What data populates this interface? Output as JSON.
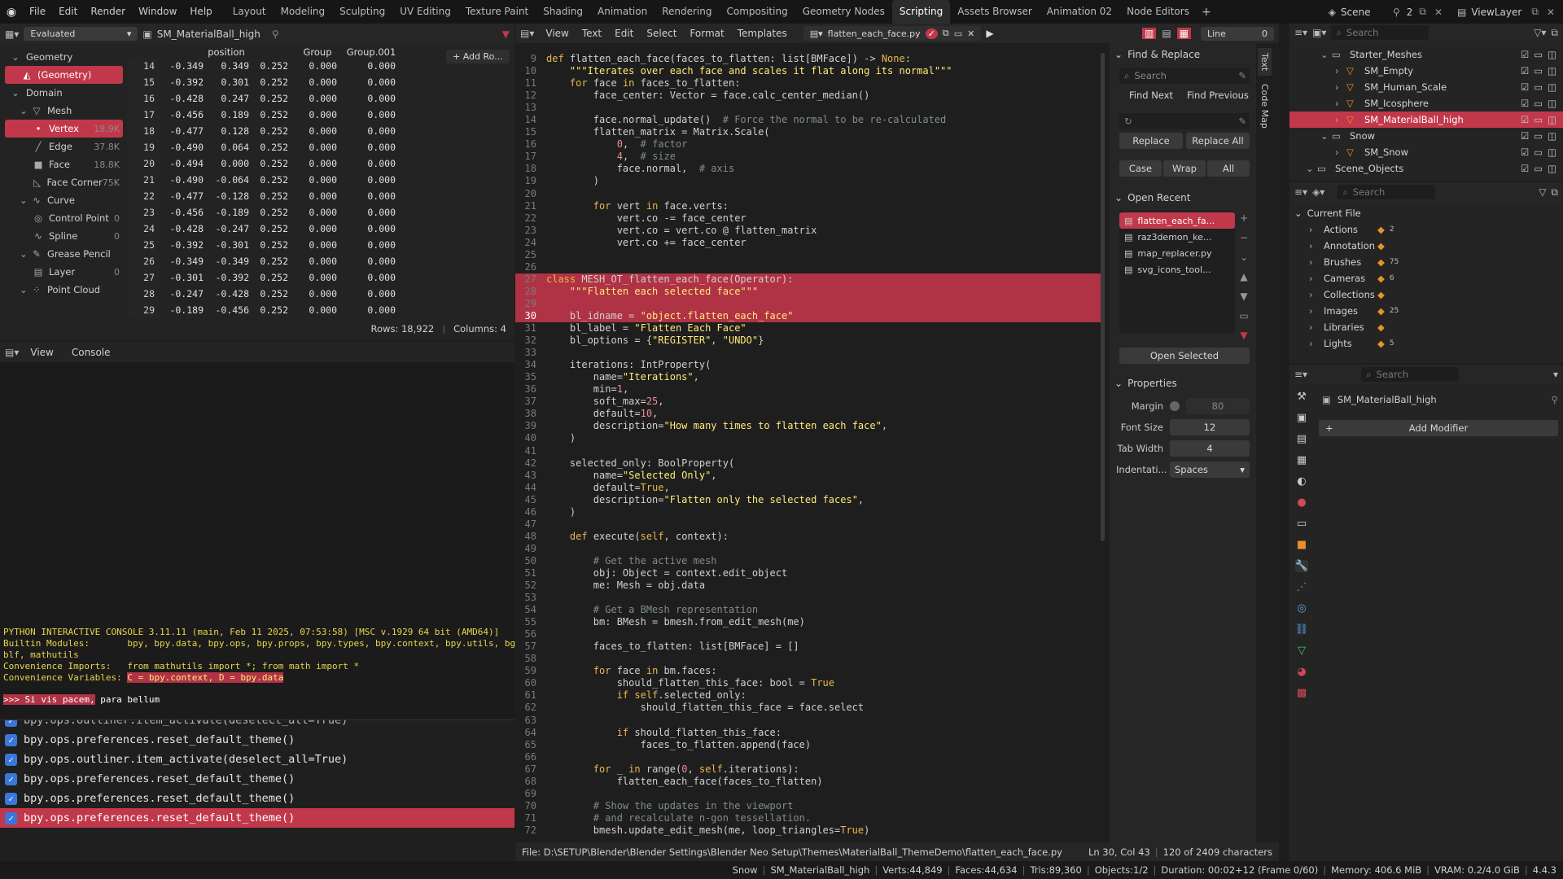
{
  "topbar": {
    "menus": [
      "File",
      "Edit",
      "Render",
      "Window",
      "Help"
    ],
    "workspaces": [
      "Layout",
      "Modeling",
      "Sculpting",
      "UV Editing",
      "Texture Paint",
      "Shading",
      "Animation",
      "Rendering",
      "Compositing",
      "Geometry Nodes",
      "Scripting",
      "Assets Browser",
      "Animation 02",
      "Node Editors"
    ],
    "active_workspace": "Scripting",
    "scene": "Scene",
    "scene_users": "2",
    "view_layer": "ViewLayer"
  },
  "spreadsheet": {
    "evaluated": "Evaluated",
    "object": "SM_MaterialBall_high",
    "tree": [
      {
        "label": "Geometry",
        "count": "",
        "level": 0,
        "sel": false,
        "icon": "chevron-down"
      },
      {
        "label": "(Geometry)",
        "count": "",
        "level": 1,
        "sel": true,
        "icon": "geometry"
      },
      {
        "label": "Domain",
        "count": "",
        "level": 0,
        "sel": false,
        "icon": "chevron-down"
      },
      {
        "label": "Mesh",
        "count": "",
        "level": 1,
        "sel": false,
        "icon": "mesh"
      },
      {
        "label": "Vertex",
        "count": "18.9K",
        "level": 2,
        "sel": true,
        "icon": "vertex"
      },
      {
        "label": "Edge",
        "count": "37.8K",
        "level": 2,
        "sel": false,
        "icon": "edge"
      },
      {
        "label": "Face",
        "count": "18.8K",
        "level": 2,
        "sel": false,
        "icon": "face"
      },
      {
        "label": "Face Corner",
        "count": "75K",
        "level": 2,
        "sel": false,
        "icon": "corner"
      },
      {
        "label": "Curve",
        "count": "",
        "level": 1,
        "sel": false,
        "icon": "curve"
      },
      {
        "label": "Control Point",
        "count": "0",
        "level": 2,
        "sel": false,
        "icon": "point"
      },
      {
        "label": "Spline",
        "count": "0",
        "level": 2,
        "sel": false,
        "icon": "spline"
      },
      {
        "label": "Grease Pencil",
        "count": "",
        "level": 1,
        "sel": false,
        "icon": "gp"
      },
      {
        "label": "Layer",
        "count": "0",
        "level": 2,
        "sel": false,
        "icon": "layer"
      },
      {
        "label": "Point Cloud",
        "count": "",
        "level": 1,
        "sel": false,
        "icon": "cloud"
      }
    ],
    "columns": [
      "position",
      "",
      "",
      "Group",
      "Group.001"
    ],
    "add_row": "+ Add Ro...",
    "rows": [
      [
        "14",
        "-0.349",
        "0.349",
        "0.252",
        "0.000",
        "0.000"
      ],
      [
        "15",
        "-0.392",
        "0.301",
        "0.252",
        "0.000",
        "0.000"
      ],
      [
        "16",
        "-0.428",
        "0.247",
        "0.252",
        "0.000",
        "0.000"
      ],
      [
        "17",
        "-0.456",
        "0.189",
        "0.252",
        "0.000",
        "0.000"
      ],
      [
        "18",
        "-0.477",
        "0.128",
        "0.252",
        "0.000",
        "0.000"
      ],
      [
        "19",
        "-0.490",
        "0.064",
        "0.252",
        "0.000",
        "0.000"
      ],
      [
        "20",
        "-0.494",
        "0.000",
        "0.252",
        "0.000",
        "0.000"
      ],
      [
        "21",
        "-0.490",
        "-0.064",
        "0.252",
        "0.000",
        "0.000"
      ],
      [
        "22",
        "-0.477",
        "-0.128",
        "0.252",
        "0.000",
        "0.000"
      ],
      [
        "23",
        "-0.456",
        "-0.189",
        "0.252",
        "0.000",
        "0.000"
      ],
      [
        "24",
        "-0.428",
        "-0.247",
        "0.252",
        "0.000",
        "0.000"
      ],
      [
        "25",
        "-0.392",
        "-0.301",
        "0.252",
        "0.000",
        "0.000"
      ],
      [
        "26",
        "-0.349",
        "-0.349",
        "0.252",
        "0.000",
        "0.000"
      ],
      [
        "27",
        "-0.301",
        "-0.392",
        "0.252",
        "0.000",
        "0.000"
      ],
      [
        "28",
        "-0.247",
        "-0.428",
        "0.252",
        "0.000",
        "0.000"
      ],
      [
        "29",
        "-0.189",
        "-0.456",
        "0.252",
        "0.000",
        "0.000"
      ]
    ],
    "footer": {
      "rows": "Rows: 18,922",
      "columns": "Columns: 4"
    }
  },
  "console": {
    "menus": [
      "View",
      "Console"
    ],
    "lines": [
      "PYTHON INTERACTIVE CONSOLE 3.11.11 (main, Feb 11 2025, 07:53:58) [MSC v.1929 64 bit (AMD64)]",
      "",
      "Builtin Modules:       bpy, bpy.data, bpy.ops, bpy.props, bpy.types, bpy.context, bpy.utils, bgl, gpu,",
      "blf, mathutils",
      "Convenience Imports:   from mathutils import *; from math import *",
      "Convenience Variables: "
    ],
    "conv_vars": "C = bpy.context, D = bpy.data",
    "prompt": ">>> Si vis pacem,",
    "prompt_rest": " para bellum"
  },
  "info": {
    "top_clipped": "bpy.ops.outliner.item_activate(deselect_all=True)",
    "items": [
      "bpy.ops.preferences.reset_default_theme()",
      "bpy.ops.outliner.item_activate(deselect_all=True)",
      "bpy.ops.preferences.reset_default_theme()",
      "bpy.ops.preferences.reset_default_theme()",
      "bpy.ops.preferences.reset_default_theme()"
    ]
  },
  "text_editor": {
    "menus": [
      "View",
      "Text",
      "Edit",
      "Select",
      "Format",
      "Templates"
    ],
    "filename": "flatten_each_face.py",
    "line_label": "Line",
    "line_value": "0",
    "side_tabs": [
      "Text",
      "Code Map"
    ],
    "filepath": "File: D:\\SETUP\\Blender\\Blender Settings\\Blender Neo Setup\\Themes\\MaterialBall_ThemeDemo\\flatten_each_face.py",
    "cursor": "Ln 30, Col 43",
    "chars": "120 of 2409 characters",
    "first_line": 9,
    "current_line": 30,
    "code": [
      "def flatten_each_face(faces_to_flatten: list[BMFace]) -> None:",
      "    \"\"\"Iterates over each face and scales it flat along its normal\"\"\"",
      "    for face in faces_to_flatten:",
      "        face_center: Vector = face.calc_center_median()",
      "",
      "        face.normal_update()  # Force the normal to be re-calculated",
      "        flatten_matrix = Matrix.Scale(",
      "            0,  # factor",
      "            4,  # size",
      "            face.normal,  # axis",
      "        )",
      "",
      "        for vert in face.verts:",
      "            vert.co -= face_center",
      "            vert.co = vert.co @ flatten_matrix",
      "            vert.co += face_center",
      "",
      "",
      "class MESH_OT_flatten_each_face(Operator):",
      "    \"\"\"Flatten each selected face\"\"\"",
      "",
      "    bl_idname = \"object.flatten_each_face\"",
      "    bl_label = \"Flatten Each Face\"",
      "    bl_options = {\"REGISTER\", \"UNDO\"}",
      "",
      "    iterations: IntProperty(",
      "        name=\"Iterations\",",
      "        min=1,",
      "        soft_max=25,",
      "        default=10,",
      "        description=\"How many times to flatten each face\",",
      "    )",
      "",
      "    selected_only: BoolProperty(",
      "        name=\"Selected Only\",",
      "        default=True,",
      "        description=\"Flatten only the selected faces\",",
      "    )",
      "",
      "    def execute(self, context):",
      "",
      "        # Get the active mesh",
      "        obj: Object = context.edit_object",
      "        me: Mesh = obj.data",
      "",
      "        # Get a BMesh representation",
      "        bm: BMesh = bmesh.from_edit_mesh(me)",
      "",
      "        faces_to_flatten: list[BMFace] = []",
      "",
      "        for face in bm.faces:",
      "            should_flatten_this_face: bool = True",
      "            if self.selected_only:",
      "                should_flatten_this_face = face.select",
      "",
      "            if should_flatten_this_face:",
      "                faces_to_flatten.append(face)",
      "",
      "        for _ in range(0, self.iterations):",
      "            flatten_each_face(faces_to_flatten)",
      "",
      "        # Show the updates in the viewport",
      "        # and recalculate n-gon tessellation.",
      "        bmesh.update_edit_mesh(me, loop_triangles=True)"
    ]
  },
  "find_replace": {
    "title": "Find & Replace",
    "search_placeholder": "Search",
    "find_next": "Find Next",
    "find_previous": "Find Previous",
    "replace": "Replace",
    "replace_all": "Replace All",
    "case": "Case",
    "wrap": "Wrap",
    "all": "All"
  },
  "open_recent": {
    "title": "Open Recent",
    "items": [
      "flatten_each_fa...",
      "raz3demon_ke...",
      "map_replacer.py",
      "svg_icons_tool..."
    ],
    "open_selected": "Open Selected"
  },
  "properties": {
    "title": "Properties",
    "margin_label": "Margin",
    "margin_value": "80",
    "font_size_label": "Font Size",
    "font_size_value": "12",
    "tab_width_label": "Tab Width",
    "tab_width_value": "4",
    "indent_label": "Indentati...",
    "indent_value": "Spaces"
  },
  "outliner": {
    "search_placeholder": "Search",
    "rows": [
      {
        "label": "Starter_Meshes",
        "level": 1,
        "sel": false,
        "type": "collection"
      },
      {
        "label": "SM_Empty",
        "level": 2,
        "sel": false,
        "type": "object"
      },
      {
        "label": "SM_Human_Scale",
        "level": 2,
        "sel": false,
        "type": "object"
      },
      {
        "label": "SM_Icosphere",
        "level": 2,
        "sel": false,
        "type": "object"
      },
      {
        "label": "SM_MaterialBall_high",
        "level": 2,
        "sel": true,
        "type": "object"
      },
      {
        "label": "Snow",
        "level": 1,
        "sel": false,
        "type": "collection"
      },
      {
        "label": "SM_Snow",
        "level": 2,
        "sel": false,
        "type": "object"
      },
      {
        "label": "Scene_Objects",
        "level": 0,
        "sel": false,
        "type": "collection"
      }
    ]
  },
  "data_api": {
    "search_placeholder": "Search",
    "root": "Current File",
    "items": [
      {
        "label": "Actions",
        "badge": "2"
      },
      {
        "label": "Annotation",
        "badge": ""
      },
      {
        "label": "Brushes",
        "badge": "75"
      },
      {
        "label": "Cameras",
        "badge": "6"
      },
      {
        "label": "Collections",
        "badge": ""
      },
      {
        "label": "Images",
        "badge": "25"
      },
      {
        "label": "Libraries",
        "badge": ""
      },
      {
        "label": "Lights",
        "badge": "5"
      }
    ]
  },
  "modifiers": {
    "search_placeholder": "Search",
    "object": "SM_MaterialBall_high",
    "add_modifier": "Add Modifier"
  },
  "status": {
    "items": [
      "Snow",
      "SM_MaterialBall_high",
      "Verts:44,849",
      "Faces:44,634",
      "Tris:89,360",
      "Objects:1/2",
      "Duration: 00:02+12 (Frame 0/60)",
      "Memory: 406.6 MiB",
      "VRAM: 0.2/4.0 GiB",
      "4.4.3"
    ]
  },
  "colors": {
    "accent": "#c1384b",
    "bg": "#1d1d1d",
    "panel": "#2b2b2b",
    "keyword": "#e8b84b",
    "string": "#ffea7a",
    "console": "#e8d64a"
  }
}
